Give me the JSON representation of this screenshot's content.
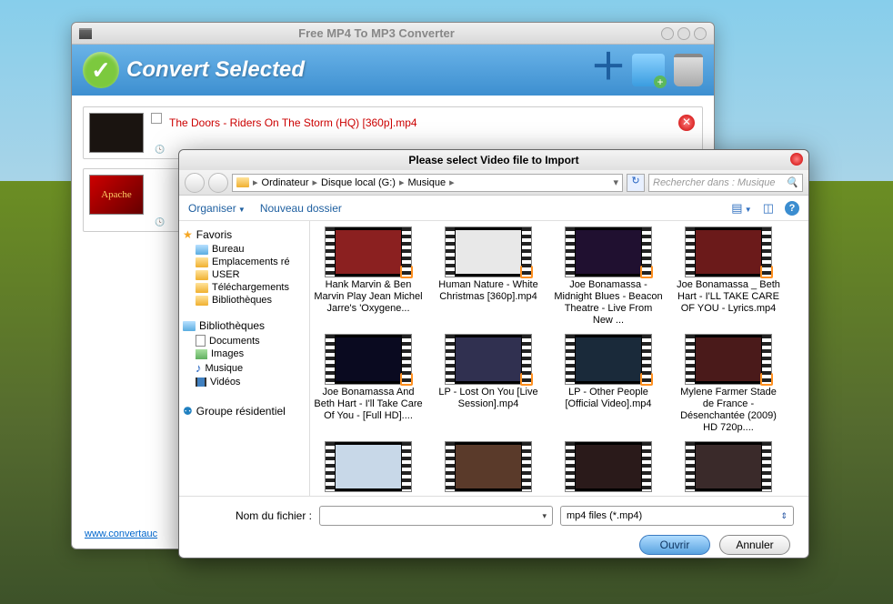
{
  "main_window": {
    "title": "Free MP4 To MP3 Converter",
    "header_label": "Convert Selected",
    "footer_link": "www.convertauc",
    "items": [
      {
        "name": "The Doors - Riders On The Storm (HQ) [360p].mp4"
      }
    ]
  },
  "dialog": {
    "title": "Please select Video file to Import",
    "breadcrumb": [
      "Ordinateur",
      "Disque local (G:)",
      "Musique"
    ],
    "search_placeholder": "Rechercher dans : Musique",
    "toolbar": {
      "organize": "Organiser",
      "new_folder": "Nouveau dossier"
    },
    "sidebar": {
      "favorites_label": "Favoris",
      "favorites": [
        "Bureau",
        "Emplacements ré",
        "USER",
        "Téléchargements",
        "Bibliothèques"
      ],
      "libraries_label": "Bibliothèques",
      "libraries": [
        "Documents",
        "Images",
        "Musique",
        "Vidéos"
      ],
      "homegroup": "Groupe résidentiel"
    },
    "files": [
      "Hank Marvin & Ben Marvin Play Jean Michel Jarre's 'Oxygene...",
      "Human Nature - White Christmas [360p].mp4",
      "Joe Bonamassa - Midnight Blues - Beacon Theatre - Live From New ...",
      "Joe Bonamassa _ Beth Hart - I'LL TAKE CARE OF YOU - Lyrics.mp4",
      "Joe Bonamassa And Beth Hart - I'll Take Care Of You - [Full HD]....",
      "LP - Lost On You [Live Session].mp4",
      "LP - Other People [Official Video].mp4",
      "Mylene Farmer Stade de France - Désenchantée (2009) HD 720p...."
    ],
    "filename_label": "Nom du fichier :",
    "filename_value": "",
    "filetype": "mp4 files (*.mp4)",
    "open": "Ouvrir",
    "cancel": "Annuler"
  }
}
